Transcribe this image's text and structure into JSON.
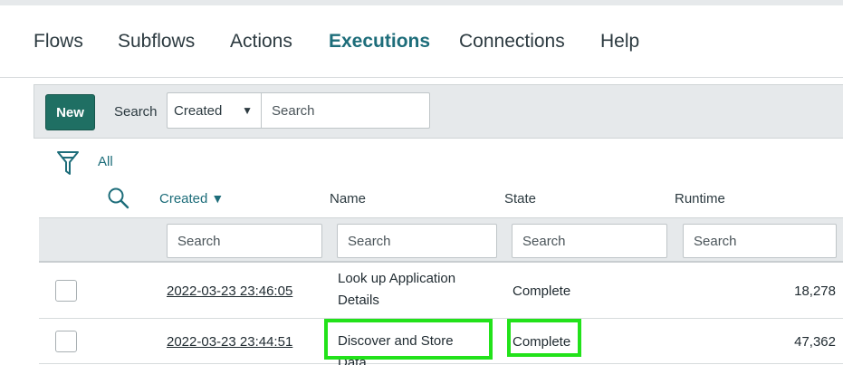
{
  "nav": {
    "items": [
      "Flows",
      "Subflows",
      "Actions",
      "Executions",
      "Connections",
      "Help"
    ],
    "active": "Executions"
  },
  "toolbar": {
    "new_label": "New",
    "search_label": "Search",
    "search_field": "Created",
    "search_placeholder": "Search"
  },
  "filter": {
    "label": "All"
  },
  "table": {
    "columns": [
      "Created",
      "Name",
      "State",
      "Runtime"
    ],
    "sorted_column": "Created",
    "sort_arrow": "▼",
    "column_search_placeholder": "Search",
    "rows": [
      {
        "created": "2022-03-23 23:46:05",
        "name": "Look up Application Details",
        "state": "Complete",
        "runtime": "18,278"
      },
      {
        "created": "2022-03-23 23:44:51",
        "name": "Discover and Store Data",
        "state": "Complete",
        "runtime": "47,362"
      }
    ]
  },
  "colors": {
    "accent": "#1d6d7a",
    "new_button": "#1f6f63",
    "highlight": "#22e21a"
  },
  "icons": [
    "funnel-icon",
    "magnifier-icon",
    "caret-down-icon"
  ]
}
